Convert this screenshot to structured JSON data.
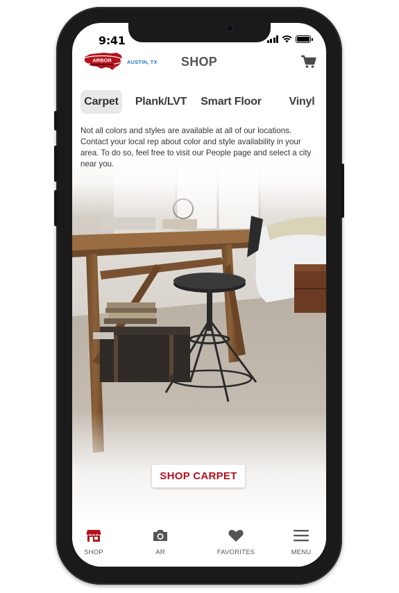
{
  "status_bar": {
    "time": "9:41"
  },
  "header": {
    "logo_text": "ARBOR",
    "location": "AUSTIN, TX",
    "title": "SHOP"
  },
  "category_tabs": [
    {
      "label": "Carpet",
      "active": true
    },
    {
      "label": "Plank/LVT",
      "active": false
    },
    {
      "label": "Smart Floor",
      "active": false
    },
    {
      "label": "Vinyl",
      "active": false
    }
  ],
  "notice": "Not all colors and styles are available at all of our locations. Contact your local rep about color and style availability in your area. To do so, feel free to visit our People page and select a city near you.",
  "hero": {
    "cta_label": "SHOP CARPET"
  },
  "bottom_nav": [
    {
      "label": "SHOP",
      "icon": "storefront-icon",
      "active": true
    },
    {
      "label": "AR",
      "icon": "camera-icon",
      "active": false
    },
    {
      "label": "FAVORITES",
      "icon": "heart-icon",
      "active": false
    },
    {
      "label": "MENU",
      "icon": "hamburger-icon",
      "active": false
    }
  ],
  "colors": {
    "brand_red": "#b3121d",
    "location_blue": "#1e78c8",
    "tab_active_bg": "#e8e8e8",
    "text_gray": "#555555"
  }
}
